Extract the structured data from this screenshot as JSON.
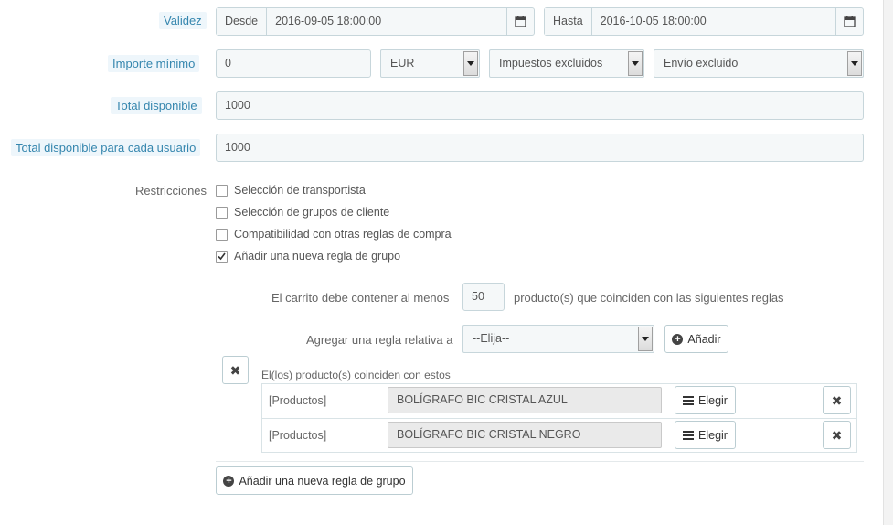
{
  "validez": {
    "label": "Validez",
    "desde_label": "Desde",
    "desde_value": "2016-09-05 18:00:00",
    "hasta_label": "Hasta",
    "hasta_value": "2016-10-05 18:00:00"
  },
  "importe": {
    "label": "Importe mínimo",
    "value": "0",
    "currency": "EUR",
    "tax": "Impuestos excluidos",
    "shipping": "Envío excluido"
  },
  "total_disponible": {
    "label": "Total disponible",
    "value": "1000"
  },
  "total_usuario": {
    "label": "Total disponible para cada usuario",
    "value": "1000"
  },
  "restricciones": {
    "label": "Restricciones",
    "items": [
      {
        "label": "Selección de transportista",
        "checked": false
      },
      {
        "label": "Selección de grupos de cliente",
        "checked": false
      },
      {
        "label": "Compatibilidad con otras reglas de compra",
        "checked": false
      },
      {
        "label": "Añadir una nueva regla de grupo",
        "checked": true
      }
    ]
  },
  "group_rule": {
    "carrito_prefix": "El carrito debe contener al menos",
    "quantity": "50",
    "carrito_suffix": "producto(s) que coinciden con las siguientes reglas",
    "agregar_label": "Agregar una regla relativa a",
    "agregar_select": "--Elija--",
    "anadir_button": "Añadir",
    "match_label": "El(los) producto(s) coinciden con estos",
    "rules": [
      {
        "type": "[Productos]",
        "value": "BOLÍGRAFO BIC CRISTAL AZUL",
        "choose": "Elegir"
      },
      {
        "type": "[Productos]",
        "value": "BOLÍGRAFO BIC CRISTAL NEGRO",
        "choose": "Elegir"
      }
    ]
  },
  "add_group_button": "Añadir una nueva regla de grupo"
}
